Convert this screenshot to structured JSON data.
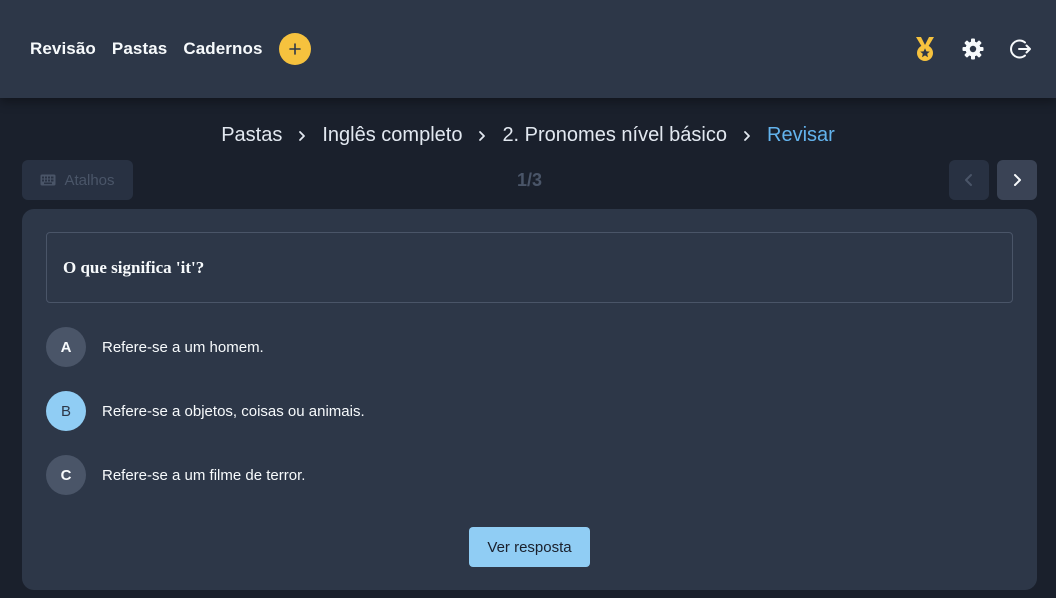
{
  "nav": {
    "links": [
      "Revisão",
      "Pastas",
      "Cadernos"
    ],
    "add_label": "+"
  },
  "icons": {
    "add": "plus-icon",
    "medal": "medal-icon",
    "settings": "gear-icon",
    "logout": "logout-icon",
    "keyboard": "keyboard-icon",
    "prev": "chevron-left-icon",
    "next": "chevron-right-icon",
    "separator": "chevron-right-icon"
  },
  "colors": {
    "accent_yellow": "#f6c23e",
    "accent_blue": "#63b3ed",
    "button_blue": "#90cdf4",
    "panel": "#2d3748",
    "background": "#1a202c"
  },
  "breadcrumb": [
    {
      "label": "Pastas",
      "active": false
    },
    {
      "label": "Inglês completo",
      "active": false
    },
    {
      "label": "2. Pronomes nível básico",
      "active": false
    },
    {
      "label": "Revisar",
      "active": true
    }
  ],
  "toolbar": {
    "shortcuts_label": "Atalhos",
    "counter": "1/3"
  },
  "question": {
    "text": "O que significa 'it'?",
    "options": [
      {
        "letter": "A",
        "text": "Refere-se a um homem.",
        "selected": false
      },
      {
        "letter": "B",
        "text": "Refere-se a objetos, coisas ou animais.",
        "selected": true
      },
      {
        "letter": "C",
        "text": "Refere-se a um filme de terror.",
        "selected": false
      }
    ]
  },
  "answer_button": "Ver resposta"
}
